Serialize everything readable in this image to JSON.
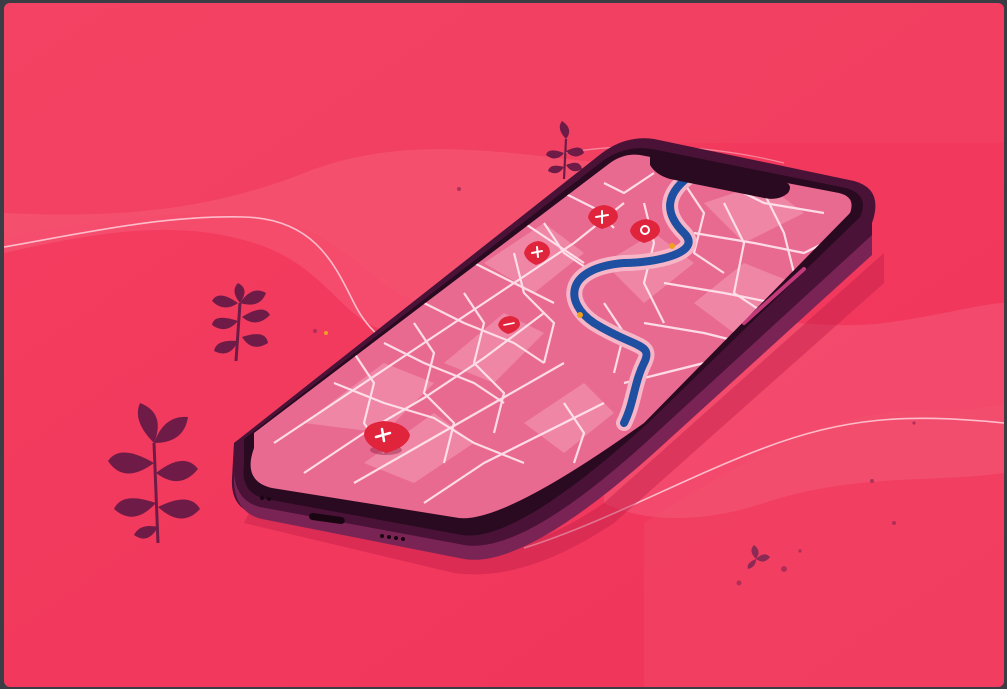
{
  "illustration": {
    "subject": "smartphone-map",
    "colors": {
      "background": "#f23a5c",
      "background_light": "#f7587a",
      "wave_line": "#ffd1dc",
      "phone_body": "#5c1842",
      "phone_bezel": "#2a0a20",
      "map_base": "#e96a90",
      "map_block": "#f08aa8",
      "map_road": "#ffe3ec",
      "river": "#1f4fa0",
      "river_edge": "#f6b6c8",
      "pin": "#e0243c",
      "leaf": "#6e1c47"
    },
    "icons": [
      "pin-icon",
      "leaf-icon"
    ]
  }
}
